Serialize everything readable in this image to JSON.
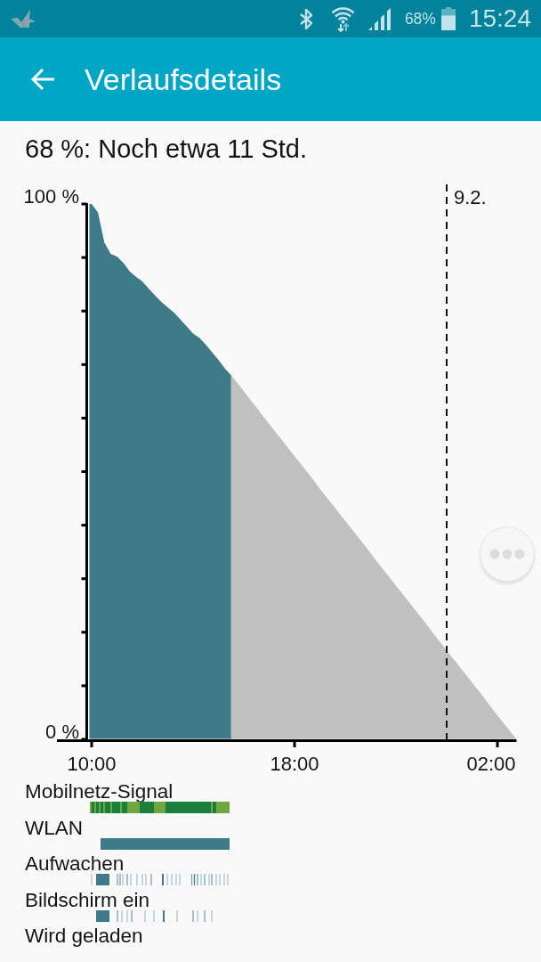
{
  "status_bar": {
    "battery_percent": "68%",
    "time": "15:24"
  },
  "app_bar": {
    "title": "Verlaufsdetails"
  },
  "summary": "68 %: Noch etwa 11 Std.",
  "history_chart": {
    "chart_data": {
      "type": "area",
      "categories": [
        "10:00",
        null,
        null,
        null,
        null,
        null,
        null,
        null,
        null,
        null,
        null,
        null,
        null,
        null,
        null,
        null,
        null,
        null,
        null,
        null,
        null,
        null,
        null,
        null,
        null,
        null,
        null,
        null,
        null,
        null,
        null,
        null,
        "18:00",
        null,
        null,
        null,
        null,
        null,
        null,
        null,
        null,
        null,
        null,
        null,
        null,
        null,
        null,
        null,
        null,
        null,
        null,
        null,
        null,
        null,
        null,
        null,
        null,
        null,
        null,
        null,
        null,
        null,
        null,
        null,
        "02:00",
        null,
        null,
        null
      ],
      "series": [
        {
          "color": "#3f7a89",
          "values": [
            100,
            98.4,
            92.8,
            90.7,
            90.2,
            89.0,
            87.4,
            86.4,
            85.5,
            84.2,
            82.9,
            81.7,
            80.7,
            79.7,
            78.4,
            77.1,
            75.8,
            75.0,
            73.7,
            72.3,
            70.9,
            69.3,
            68,
            null,
            null,
            null,
            null,
            null,
            null,
            null,
            null,
            null,
            null,
            null,
            null,
            null,
            null,
            null,
            null,
            null,
            null,
            null,
            null,
            null,
            null,
            null,
            null,
            null,
            null,
            null,
            null,
            null,
            null,
            null,
            null,
            null,
            null,
            null,
            null,
            null,
            null,
            null,
            null,
            null,
            null,
            null,
            null,
            null
          ]
        },
        {
          "color": "#c0c0c0",
          "values": [
            null,
            null,
            null,
            null,
            null,
            null,
            null,
            null,
            null,
            null,
            null,
            null,
            null,
            null,
            null,
            null,
            null,
            null,
            null,
            null,
            null,
            null,
            68,
            66.5,
            65.0,
            63.5,
            62.0,
            60.4,
            58.9,
            57.4,
            55.9,
            54.4,
            52.9,
            51.4,
            49.9,
            48.4,
            46.8,
            45.3,
            43.8,
            42.3,
            40.8,
            39.3,
            37.8,
            36.3,
            34.8,
            33.2,
            31.7,
            30.2,
            28.7,
            27.2,
            25.7,
            24.2,
            22.7,
            21.2,
            19.6,
            18.1,
            16.6,
            15.1,
            13.6,
            12.1,
            10.6,
            9.1,
            7.6,
            6.0,
            4.5,
            3.0,
            1.5,
            0
          ]
        }
      ],
      "ylim": [
        0,
        100
      ],
      "yticks": [
        {
          "value": 0,
          "label": "0 %"
        },
        {
          "value": 100,
          "label": "100 %"
        }
      ],
      "annotations": [
        "9.2."
      ]
    }
  },
  "timelines": [
    {
      "label": "Mobilnetz-Signal",
      "kind": "signal"
    },
    {
      "label": "WLAN",
      "kind": "wifi"
    },
    {
      "label": "Aufwachen",
      "kind": "wake"
    },
    {
      "label": "Bildschirm ein",
      "kind": "screen"
    },
    {
      "label": "Wird geladen",
      "kind": "charging"
    }
  ]
}
